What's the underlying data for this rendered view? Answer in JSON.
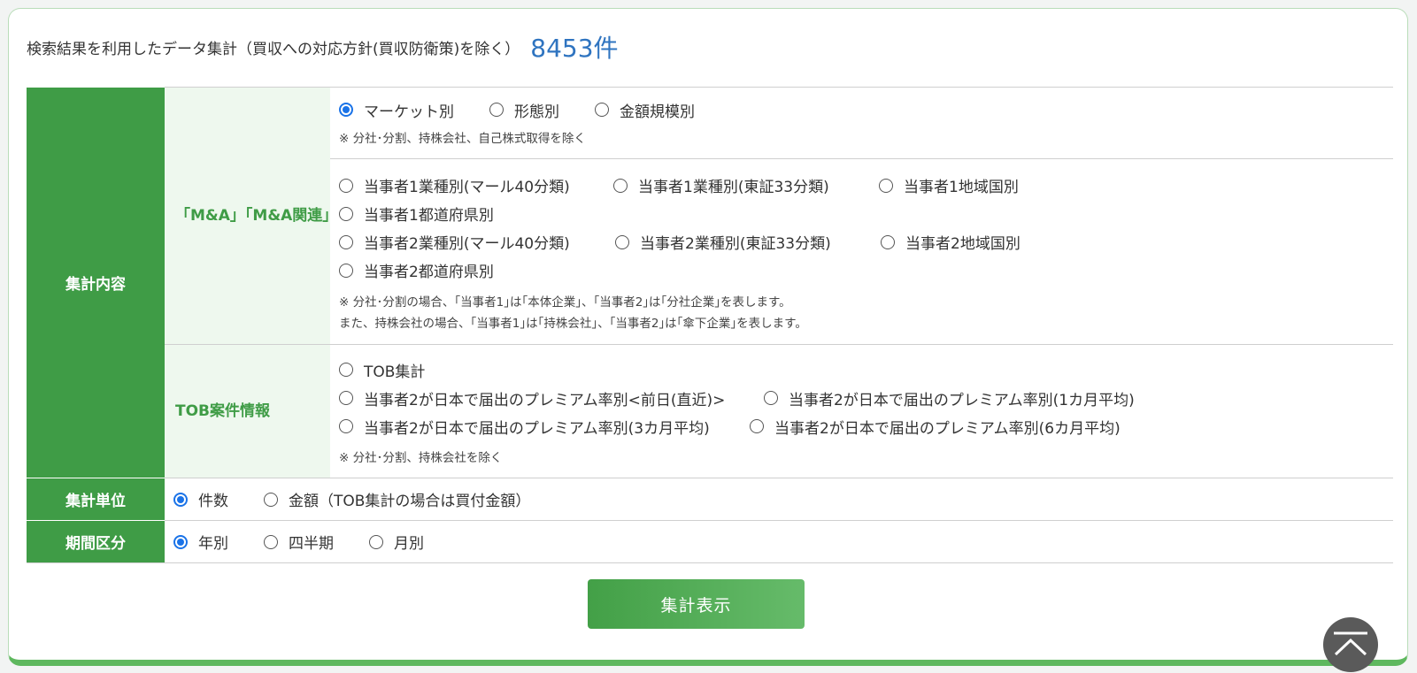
{
  "heading": {
    "text": "検索結果を利用したデータ集計（買収への対応方針(買収防衛策)を除く）",
    "count": "8453件"
  },
  "content_label": "集計内容",
  "ma": {
    "label": "「M&A」「M&A関連」",
    "group1": {
      "opts": [
        "マーケット別",
        "形態別",
        "金額規模別"
      ],
      "selected": 0,
      "note": "※ 分社･分割、持株会社、自己株式取得を除く"
    },
    "group2": {
      "line1": [
        "当事者1業種別(マール40分類)",
        "当事者1業種別(東証33分類)",
        "当事者1地域国別"
      ],
      "line2": [
        "当事者1都道府県別"
      ],
      "line3": [
        "当事者2業種別(マール40分類)",
        "当事者2業種別(東証33分類)",
        "当事者2地域国別"
      ],
      "line4": [
        "当事者2都道府県別"
      ],
      "note1": "※ 分社･分割の場合、｢当事者1｣は｢本体企業｣、｢当事者2｣は｢分社企業｣を表します。",
      "note2": "また、持株会社の場合、｢当事者1｣は｢持株会社｣、｢当事者2｣は｢傘下企業｣を表します。"
    }
  },
  "tob": {
    "label": "TOB案件情報",
    "line1": [
      "TOB集計"
    ],
    "line2": [
      "当事者2が日本で届出のプレミアム率別<前日(直近)>",
      "当事者2が日本で届出のプレミアム率別(1カ月平均)"
    ],
    "line3": [
      "当事者2が日本で届出のプレミアム率別(3カ月平均)",
      "当事者2が日本で届出のプレミアム率別(6カ月平均)"
    ],
    "note": "※ 分社･分割、持株会社を除く"
  },
  "unit": {
    "label": "集計単位",
    "opts": [
      "件数",
      "金額（TOB集計の場合は買付金額）"
    ],
    "selected": 0
  },
  "period": {
    "label": "期間区分",
    "opts": [
      "年別",
      "四半期",
      "月別"
    ],
    "selected": 0
  },
  "submit": "集計表示",
  "colors": {
    "green": "#3f9c46",
    "count_blue": "#2f74c0",
    "radio_blue": "#1a73e8"
  },
  "icons": {
    "back_to_top": "chevron-up-icon"
  }
}
